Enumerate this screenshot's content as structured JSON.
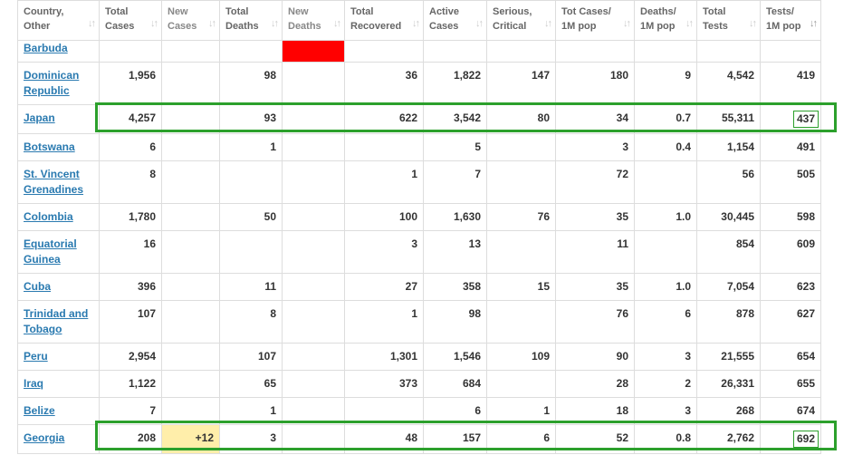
{
  "headers": [
    {
      "l1": "Country,",
      "l2": "Other"
    },
    {
      "l1": "Total",
      "l2": "Cases"
    },
    {
      "l1": "New",
      "l2": "Cases"
    },
    {
      "l1": "Total",
      "l2": "Deaths"
    },
    {
      "l1": "New",
      "l2": "Deaths"
    },
    {
      "l1": "Total",
      "l2": "Recovered"
    },
    {
      "l1": "Active",
      "l2": "Cases"
    },
    {
      "l1": "Serious,",
      "l2": "Critical"
    },
    {
      "l1": "Tot Cases/",
      "l2": "1M pop"
    },
    {
      "l1": "Deaths/",
      "l2": "1M pop"
    },
    {
      "l1": "Total",
      "l2": "Tests"
    },
    {
      "l1": "Tests/",
      "l2": "1M pop"
    }
  ],
  "sort_icon": "↓↑",
  "colors": {
    "highlight": "#2ca02c",
    "new_deaths": "#ff0000",
    "new_cases": "#ffeeaa",
    "link": "#2a7ab0"
  },
  "rows": [
    {
      "c": [
        "Barbuda",
        "",
        "",
        "",
        "",
        "",
        "",
        "",
        "",
        "",
        "",
        ""
      ]
    },
    {
      "c": [
        "Dominican Republic",
        "1,956",
        "",
        "98",
        "",
        "36",
        "1,822",
        "147",
        "180",
        "9",
        "4,542",
        "419"
      ]
    },
    {
      "c": [
        "Japan",
        "4,257",
        "",
        "93",
        "",
        "622",
        "3,542",
        "80",
        "34",
        "0.7",
        "55,311",
        "437"
      ]
    },
    {
      "c": [
        "Botswana",
        "6",
        "",
        "1",
        "",
        "",
        "5",
        "",
        "3",
        "0.4",
        "1,154",
        "491"
      ]
    },
    {
      "c": [
        "St. Vincent Grenadines",
        "8",
        "",
        "",
        "",
        "1",
        "7",
        "",
        "72",
        "",
        "56",
        "505"
      ]
    },
    {
      "c": [
        "Colombia",
        "1,780",
        "",
        "50",
        "",
        "100",
        "1,630",
        "76",
        "35",
        "1.0",
        "30,445",
        "598"
      ]
    },
    {
      "c": [
        "Equatorial Guinea",
        "16",
        "",
        "",
        "",
        "3",
        "13",
        "",
        "11",
        "",
        "854",
        "609"
      ]
    },
    {
      "c": [
        "Cuba",
        "396",
        "",
        "11",
        "",
        "27",
        "358",
        "15",
        "35",
        "1.0",
        "7,054",
        "623"
      ]
    },
    {
      "c": [
        "Trinidad and Tobago",
        "107",
        "",
        "8",
        "",
        "1",
        "98",
        "",
        "76",
        "6",
        "878",
        "627"
      ]
    },
    {
      "c": [
        "Peru",
        "2,954",
        "",
        "107",
        "",
        "1,301",
        "1,546",
        "109",
        "90",
        "3",
        "21,555",
        "654"
      ]
    },
    {
      "c": [
        "Iraq",
        "1,122",
        "",
        "65",
        "",
        "373",
        "684",
        "",
        "28",
        "2",
        "26,331",
        "655"
      ]
    },
    {
      "c": [
        "Belize",
        "7",
        "",
        "1",
        "",
        "",
        "6",
        "1",
        "18",
        "3",
        "268",
        "674"
      ]
    },
    {
      "c": [
        "Georgia",
        "208",
        "+12",
        "3",
        "",
        "48",
        "157",
        "6",
        "52",
        "0.8",
        "2,762",
        "692"
      ]
    }
  ]
}
